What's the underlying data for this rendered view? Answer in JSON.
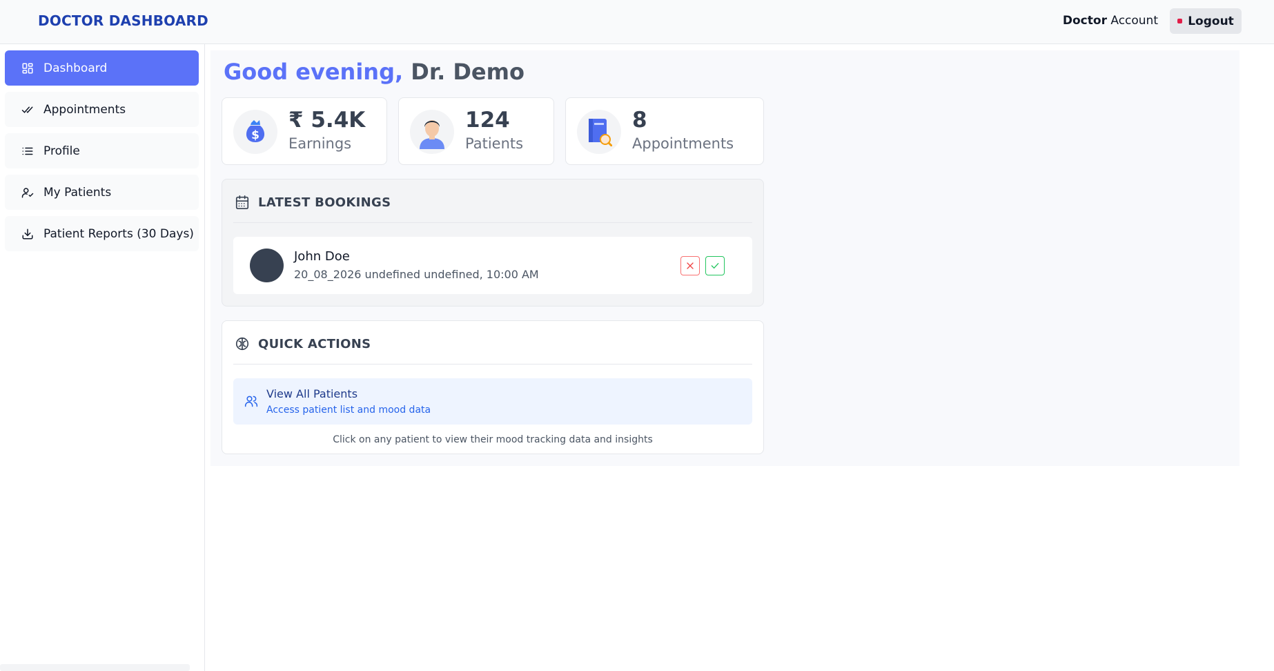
{
  "header": {
    "brand": "DOCTOR DASHBOARD",
    "account_bold": "Doctor",
    "account_rest": " Account",
    "logout_label": "Logout",
    "logout_color": "#e11d48"
  },
  "sidebar": {
    "items": [
      {
        "label": "Dashboard",
        "icon": "dashboard-grid-icon",
        "active": true
      },
      {
        "label": "Appointments",
        "icon": "double-check-icon",
        "active": false
      },
      {
        "label": "Profile",
        "icon": "list-icon",
        "active": false
      },
      {
        "label": "My Patients",
        "icon": "user-check-icon",
        "active": false
      },
      {
        "label": "Patient Reports (30 Days)",
        "icon": "download-icon",
        "active": false
      }
    ]
  },
  "main": {
    "greeting_hi": "Good evening,",
    "greeting_name": " Dr. Demo",
    "stats": [
      {
        "value": "₹ 5.4K",
        "label": "Earnings",
        "icon": "money-bag-icon"
      },
      {
        "value": "124",
        "label": "Patients",
        "icon": "patient-avatar-icon"
      },
      {
        "value": "8",
        "label": "Appointments",
        "icon": "appointment-book-icon"
      }
    ],
    "bookings": {
      "title": "LATEST BOOKINGS",
      "items": [
        {
          "name": "John Doe",
          "time": "20_08_2026 undefined undefined, 10:00 AM"
        }
      ]
    },
    "quick_actions": {
      "title": "QUICK ACTIONS",
      "items": [
        {
          "title": "View All Patients",
          "subtitle": "Access patient list and mood data"
        }
      ],
      "hint": "Click on any patient to view their mood tracking data and insights"
    }
  },
  "colors": {
    "accent": "#5b72f8",
    "brand": "#1e40af",
    "reject": "#f87171",
    "accept": "#22c55e"
  }
}
